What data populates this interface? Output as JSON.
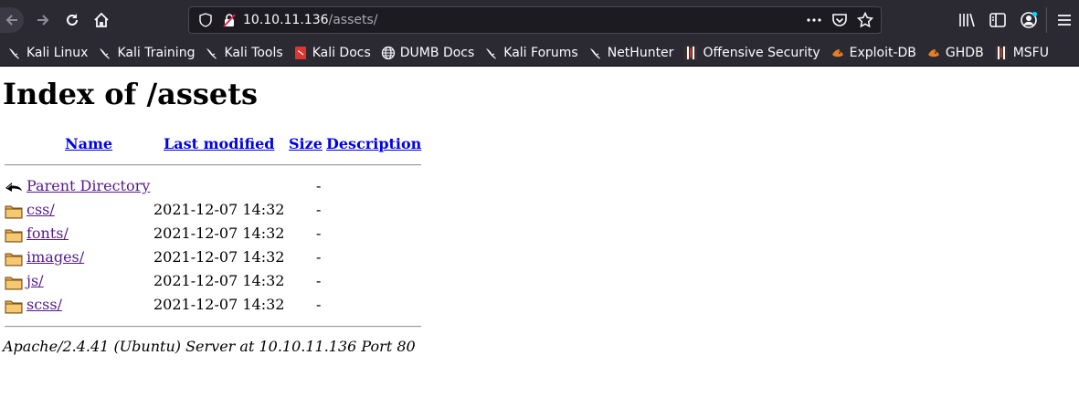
{
  "browser": {
    "url_host": "10.10.11.136",
    "url_path": "/assets/",
    "bookmarks": [
      {
        "label": "Kali Linux",
        "icon": "kali-dragon-icon"
      },
      {
        "label": "Kali Training",
        "icon": "kali-dragon-icon"
      },
      {
        "label": "Kali Tools",
        "icon": "kali-dragon-icon"
      },
      {
        "label": "Kali Docs",
        "icon": "kali-docs-icon"
      },
      {
        "label": "DUMB Docs",
        "icon": "globe-icon"
      },
      {
        "label": "Kali Forums",
        "icon": "kali-dragon-icon"
      },
      {
        "label": "NetHunter",
        "icon": "kali-dragon-icon"
      },
      {
        "label": "Offensive Security",
        "icon": "offsec-icon"
      },
      {
        "label": "Exploit-DB",
        "icon": "exploitdb-icon"
      },
      {
        "label": "GHDB",
        "icon": "exploitdb-icon"
      },
      {
        "label": "MSFU",
        "icon": "offsec-icon"
      }
    ]
  },
  "page": {
    "title": "Index of /assets",
    "columns": {
      "name": "Name",
      "last_modified": "Last modified",
      "size": "Size",
      "description": "Description"
    },
    "parent": {
      "name": "Parent Directory",
      "size": "-"
    },
    "entries": [
      {
        "name": "css/",
        "modified": "2021-12-07 14:32",
        "size": "-"
      },
      {
        "name": "fonts/",
        "modified": "2021-12-07 14:32",
        "size": "-"
      },
      {
        "name": "images/",
        "modified": "2021-12-07 14:32",
        "size": "-"
      },
      {
        "name": "js/",
        "modified": "2021-12-07 14:32",
        "size": "-"
      },
      {
        "name": "scss/",
        "modified": "2021-12-07 14:32",
        "size": "-"
      }
    ],
    "footer": "Apache/2.4.41 (Ubuntu) Server at 10.10.11.136 Port 80"
  },
  "colors": {
    "chrome_bg": "#2b2a33",
    "link": "#0000ee",
    "visited_link": "#551a8b"
  }
}
